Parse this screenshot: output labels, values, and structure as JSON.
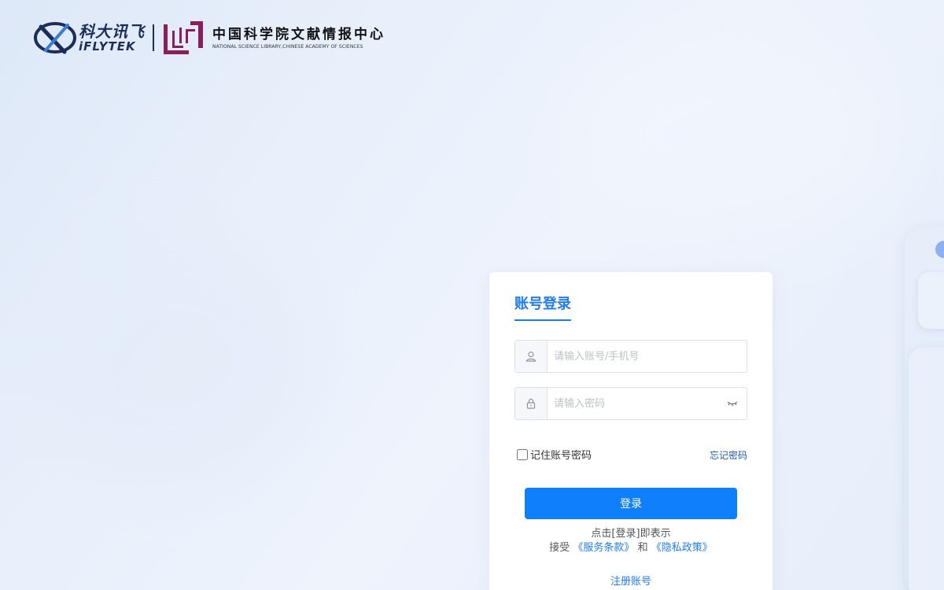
{
  "header": {
    "ifly_cn": "科大讯飞",
    "ifly_en": "iFLYTEK",
    "nsl_cn": "中国科学院文献情报中心",
    "nsl_en": "NATIONAL SCIENCE LIBRARY,CHINESE ACADEMY OF SCIENCES"
  },
  "login": {
    "tab_label": "账号登录",
    "username_placeholder": "请输入账号/手机号",
    "password_placeholder": "请输入密码",
    "remember_label": "记住账号密码",
    "forgot_label": "忘记密码",
    "submit_label": "登录",
    "agree_line1": "点击[登录]即表示",
    "agree_prefix": "接受",
    "terms_link": "《服务条款》",
    "agree_and": "和",
    "privacy_link": "《隐私政策》",
    "register_label": "注册账号"
  },
  "colors": {
    "accent": "#1f7df2",
    "button": "#0f7ffb"
  }
}
